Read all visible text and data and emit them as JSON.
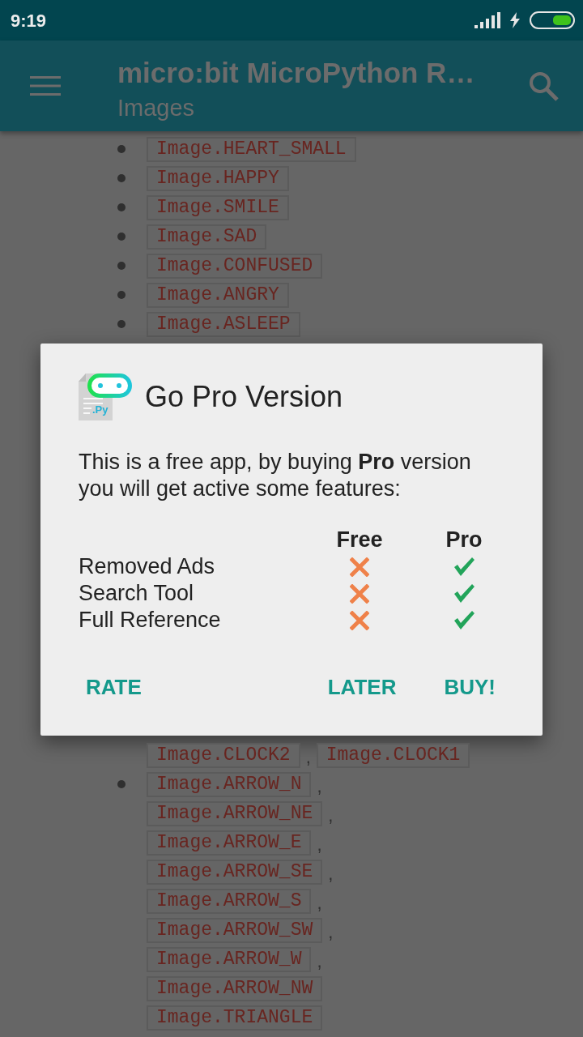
{
  "status_bar": {
    "time": "9:19"
  },
  "app_bar": {
    "title": "micro:bit MicroPython R…",
    "subtitle": "Images"
  },
  "content": {
    "lines_above_dialog": [
      {
        "bullet": true,
        "parts": [
          {
            "kind": "code",
            "text": "Image.HEART_SMALL"
          }
        ]
      },
      {
        "bullet": true,
        "parts": [
          {
            "kind": "code",
            "text": "Image.HAPPY"
          }
        ]
      },
      {
        "bullet": true,
        "parts": [
          {
            "kind": "code",
            "text": "Image.SMILE"
          }
        ]
      },
      {
        "bullet": true,
        "parts": [
          {
            "kind": "code",
            "text": "Image.SAD"
          }
        ]
      },
      {
        "bullet": true,
        "parts": [
          {
            "kind": "code",
            "text": "Image.CONFUSED"
          }
        ]
      },
      {
        "bullet": true,
        "parts": [
          {
            "kind": "code",
            "text": "Image.ANGRY"
          }
        ]
      },
      {
        "bullet": true,
        "parts": [
          {
            "kind": "code",
            "text": "Image.ASLEEP"
          }
        ]
      }
    ],
    "lines_below_dialog": [
      {
        "bullet": false,
        "parts": [
          {
            "kind": "code",
            "text": "Image.CLOCK2"
          },
          {
            "kind": "punct",
            "text": ","
          },
          {
            "kind": "code",
            "text": "Image.CLOCK1"
          }
        ]
      },
      {
        "bullet": true,
        "parts": [
          {
            "kind": "code",
            "text": "Image.ARROW_N"
          },
          {
            "kind": "punct",
            "text": ","
          }
        ]
      },
      {
        "bullet": false,
        "parts": [
          {
            "kind": "code",
            "text": "Image.ARROW_NE"
          },
          {
            "kind": "punct",
            "text": ","
          }
        ]
      },
      {
        "bullet": false,
        "parts": [
          {
            "kind": "code",
            "text": "Image.ARROW_E"
          },
          {
            "kind": "punct",
            "text": ","
          }
        ]
      },
      {
        "bullet": false,
        "parts": [
          {
            "kind": "code",
            "text": "Image.ARROW_SE"
          },
          {
            "kind": "punct",
            "text": ","
          }
        ]
      },
      {
        "bullet": false,
        "parts": [
          {
            "kind": "code",
            "text": "Image.ARROW_S"
          },
          {
            "kind": "punct",
            "text": ","
          }
        ]
      },
      {
        "bullet": false,
        "parts": [
          {
            "kind": "code",
            "text": "Image.ARROW_SW"
          },
          {
            "kind": "punct",
            "text": ","
          }
        ]
      },
      {
        "bullet": false,
        "parts": [
          {
            "kind": "code",
            "text": "Image.ARROW_W"
          },
          {
            "kind": "punct",
            "text": ","
          }
        ]
      },
      {
        "bullet": false,
        "parts": [
          {
            "kind": "code",
            "text": "Image.ARROW_NW"
          }
        ]
      },
      {
        "bullet": false,
        "parts": [
          {
            "kind": "code",
            "text": "Image.TRIANGLE"
          }
        ]
      }
    ]
  },
  "dialog": {
    "logo_text": ".Py",
    "title": "Go Pro Version",
    "message": "This is a free app, by buying **Pro** version you will get active some features:",
    "columns": [
      "Free",
      "Pro"
    ],
    "features": [
      {
        "name": "Removed Ads",
        "free": false,
        "pro": true
      },
      {
        "name": "Search Tool",
        "free": false,
        "pro": true
      },
      {
        "name": "Full Reference",
        "free": false,
        "pro": true
      }
    ],
    "buttons": [
      {
        "label": "RATE"
      },
      {
        "label": "LATER"
      },
      {
        "label": "BUY!"
      }
    ]
  }
}
